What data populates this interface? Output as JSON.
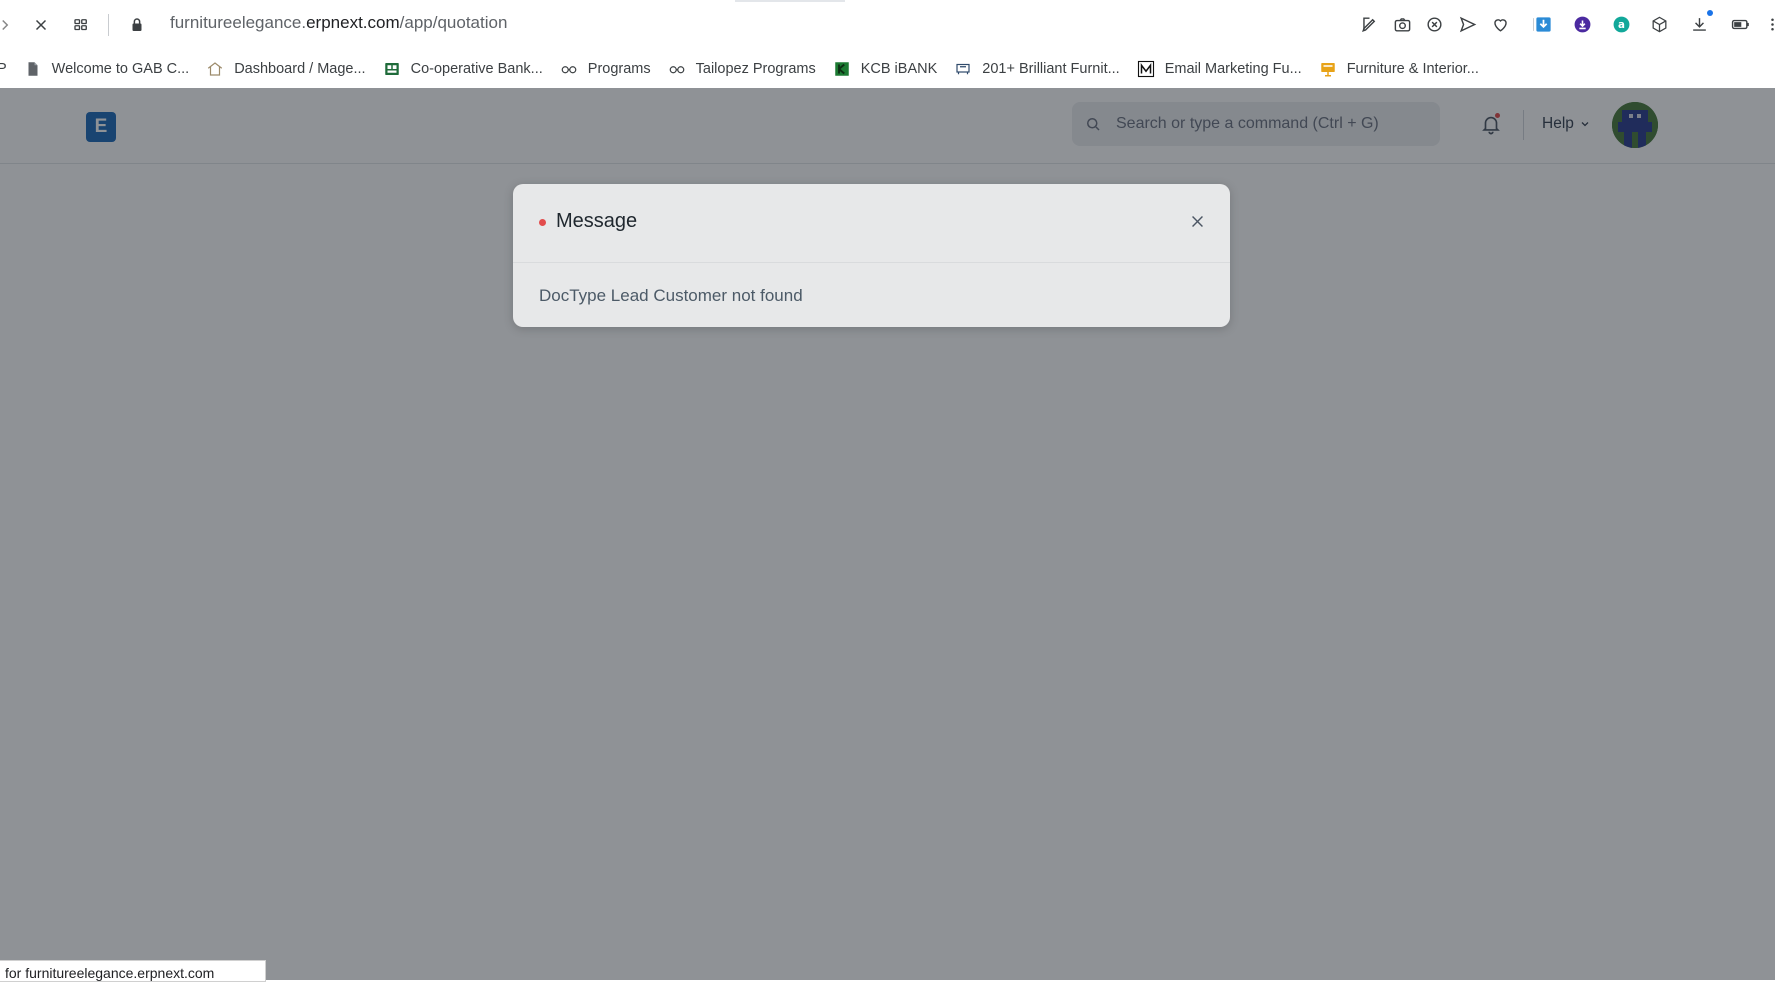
{
  "browser": {
    "url_host_pre": "furnitureelegance.",
    "url_host_main": "erpnext.com",
    "url_path": "/app/quotation",
    "bookmarks": [
      {
        "label": "P",
        "icon": "none"
      },
      {
        "label": "Welcome to GAB C...",
        "icon": "document-icon"
      },
      {
        "label": "Dashboard / Mage...",
        "icon": "house-icon"
      },
      {
        "label": "Co-operative Bank...",
        "icon": "bank-icon"
      },
      {
        "label": "Programs",
        "icon": "glasses-icon"
      },
      {
        "label": "Tailopez Programs",
        "icon": "glasses-icon"
      },
      {
        "label": "KCB iBANK",
        "icon": "kcb-icon"
      },
      {
        "label": "201+ Brilliant Furnit...",
        "icon": "furniture-icon"
      },
      {
        "label": "Email Marketing Fu...",
        "icon": "m-logo-icon"
      },
      {
        "label": "Furniture & Interior...",
        "icon": "sign-icon"
      }
    ],
    "status_text": "for furnitureelegance.erpnext.com"
  },
  "app": {
    "logo_letter": "E",
    "search_placeholder": "Search or type a command (Ctrl + G)",
    "help_label": "Help"
  },
  "modal": {
    "title": "Message",
    "body": "DocType Lead Customer not found",
    "indicator_color": "#e24c4c"
  },
  "colors": {
    "logo_blue": "#1d6ab8",
    "overlay": "rgba(20,27,36,0.48)"
  }
}
